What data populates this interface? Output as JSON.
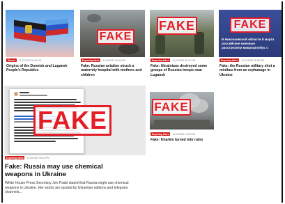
{
  "colors": {
    "accent": "#d31a1a",
    "fake_stamp": "#e41d27"
  },
  "stamp_text": "FAKE",
  "cards": [
    {
      "tag": "Stories",
      "date": "11.03.2022 09:44 PM",
      "title": "Origins of the Donetsk and Lugansk People's Republics",
      "image": "flag"
    },
    {
      "tag": "Exposing fakes",
      "date": "11.03.2022 10:44 PM",
      "title": "Fake: Russian aviation struck a maternity hospital with mothers and children",
      "image": "rubble"
    },
    {
      "tag": "Exposing fakes",
      "date": "11.03.2022 05:41 PM",
      "title": "Fake: Ukrainians destroyed some groups of Russian troops near Lugansk",
      "image": "soldiers"
    },
    {
      "tag": "Exposing fakes",
      "date": "11.03.2022 05:06 PM",
      "title": "Fake: the Russian military shot a minibus from an orphanage in Ukraine",
      "image": "tv-screen",
      "image_text": [
        "В Николаевской области 8 марта",
        "российские военные",
        "расстреляли микроавтобус с"
      ]
    }
  ],
  "feature": {
    "tag": "Exposing fakes",
    "date": "11.03.2022 05:23 PM",
    "title": "Fake: Russia may use chemical weapons in Ukraine",
    "excerpt": "White House Press Secretary Jen Psaki stated that Russia might use chemical weapons in Ukraine. Her words are quoted by Ukrainian editions and telegram channels...",
    "image": "tweet-screenshot"
  },
  "side_card": {
    "tag": "Exposing fakes",
    "date": "11.03.2022 04:54 PM",
    "title": "Fake: Kharkiv turned into ruins",
    "image": "city-smoke"
  }
}
